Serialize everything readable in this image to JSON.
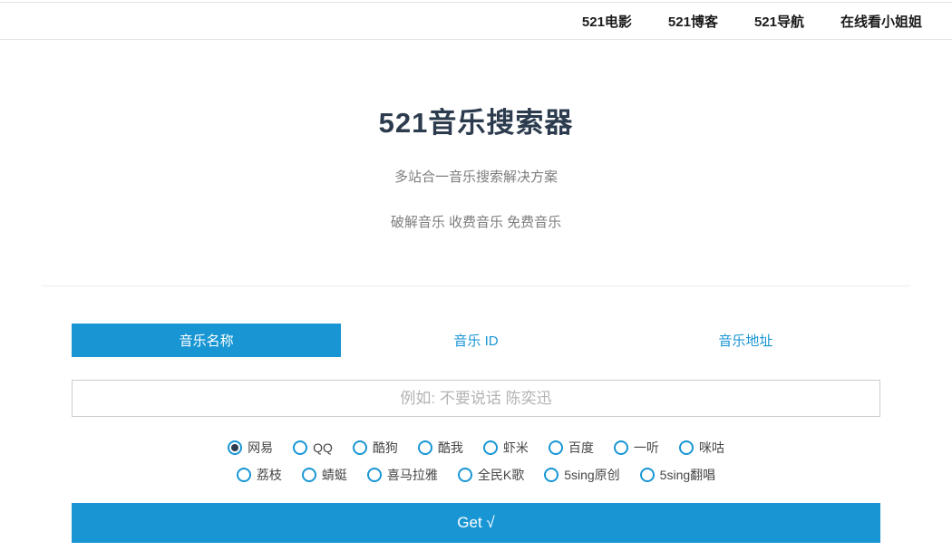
{
  "colors": {
    "accent": "#1896d4",
    "title_text": "#2c3b4e",
    "subtitle_text": "#7d7d7d",
    "radio_dot": "#2c3b4e"
  },
  "nav": {
    "items": [
      {
        "label": "521电影"
      },
      {
        "label": "521博客"
      },
      {
        "label": "521导航"
      },
      {
        "label": "在线看小姐姐"
      }
    ]
  },
  "hero": {
    "title": "521音乐搜索器",
    "subtitle1": "多站合一音乐搜索解决方案",
    "subtitle2": "破解音乐 收费音乐 免费音乐"
  },
  "tabs": [
    {
      "label": "音乐名称",
      "active": true
    },
    {
      "label": "音乐 ID",
      "active": false
    },
    {
      "label": "音乐地址",
      "active": false
    }
  ],
  "search": {
    "placeholder": "例如: 不要说话 陈奕迅",
    "value": ""
  },
  "sources": {
    "row1": [
      {
        "label": "网易",
        "selected": true
      },
      {
        "label": "QQ",
        "selected": false
      },
      {
        "label": "酷狗",
        "selected": false
      },
      {
        "label": "酷我",
        "selected": false
      },
      {
        "label": "虾米",
        "selected": false
      },
      {
        "label": "百度",
        "selected": false
      },
      {
        "label": "一听",
        "selected": false
      },
      {
        "label": "咪咕",
        "selected": false
      }
    ],
    "row2": [
      {
        "label": "荔枝",
        "selected": false
      },
      {
        "label": "蜻蜓",
        "selected": false
      },
      {
        "label": "喜马拉雅",
        "selected": false
      },
      {
        "label": "全民K歌",
        "selected": false
      },
      {
        "label": "5sing原创",
        "selected": false
      },
      {
        "label": "5sing翻唱",
        "selected": false
      }
    ]
  },
  "submit": {
    "label": "Get √"
  }
}
